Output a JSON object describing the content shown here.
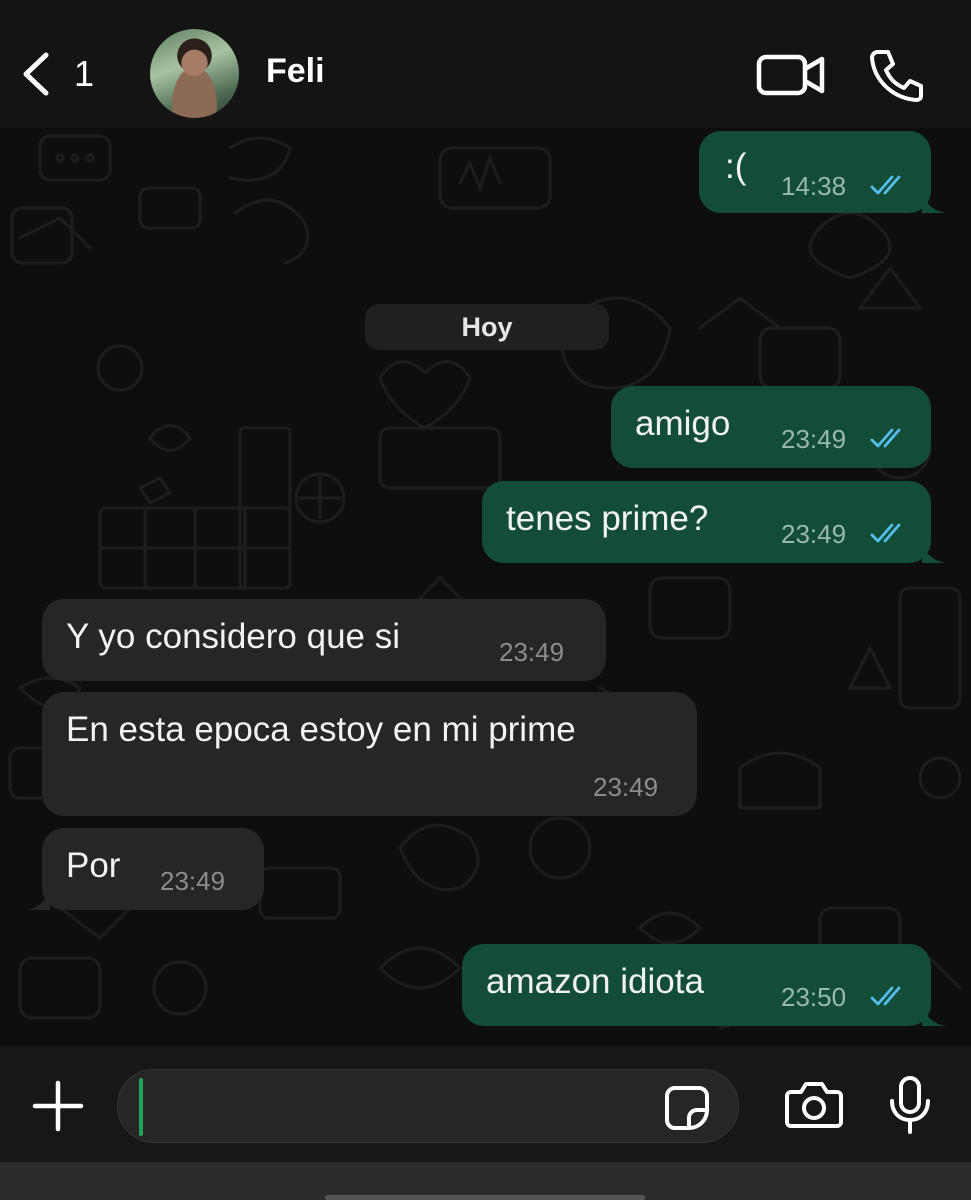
{
  "header": {
    "back_count": "1",
    "contact_name": "Feli",
    "icons": [
      "back-chevron-icon",
      "video-call-icon",
      "phone-call-icon"
    ]
  },
  "chat": {
    "day_label": "Hoy",
    "messages": [
      {
        "direction": "outgoing",
        "text": ":(",
        "time": "14:38",
        "status": "read"
      },
      {
        "direction": "outgoing",
        "text": "amigo",
        "time": "23:49",
        "status": "read"
      },
      {
        "direction": "outgoing",
        "text": "tenes prime?",
        "time": "23:49",
        "status": "read"
      },
      {
        "direction": "incoming",
        "text": "Y yo considero que si",
        "time": "23:49"
      },
      {
        "direction": "incoming",
        "text": "En esta epoca estoy en mi prime",
        "time": "23:49"
      },
      {
        "direction": "incoming",
        "text": "Por",
        "time": "23:49"
      },
      {
        "direction": "outgoing",
        "text": "amazon idiota",
        "time": "23:50",
        "status": "read"
      }
    ]
  },
  "composer": {
    "input_value": "",
    "icons": [
      "plus-icon",
      "sticker-icon",
      "camera-icon",
      "microphone-icon"
    ]
  },
  "colors": {
    "outgoing_bubble": "#144d37",
    "incoming_bubble": "#262626",
    "read_ticks": "#53bdeb",
    "background": "#0b0b0b"
  }
}
